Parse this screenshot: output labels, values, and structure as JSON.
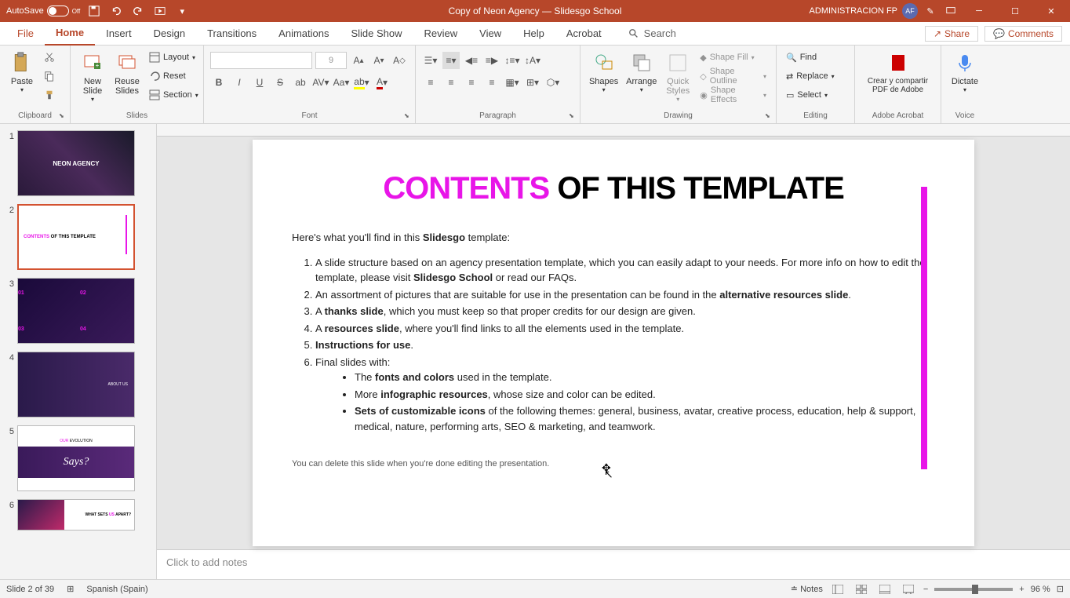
{
  "titlebar": {
    "autosave_label": "AutoSave",
    "autosave_state": "Off",
    "document_title": "Copy of Neon Agency — Slidesgo School",
    "user_name": "ADMINISTRACION FP",
    "user_initials": "AF"
  },
  "tabs": {
    "file": "File",
    "home": "Home",
    "insert": "Insert",
    "design": "Design",
    "transitions": "Transitions",
    "animations": "Animations",
    "slideshow": "Slide Show",
    "review": "Review",
    "view": "View",
    "help": "Help",
    "acrobat": "Acrobat",
    "search": "Search",
    "share": "Share",
    "comments": "Comments"
  },
  "ribbon": {
    "clipboard": {
      "label": "Clipboard",
      "paste": "Paste"
    },
    "slides": {
      "label": "Slides",
      "new_slide": "New\nSlide",
      "reuse_slides": "Reuse\nSlides",
      "layout": "Layout",
      "reset": "Reset",
      "section": "Section"
    },
    "font": {
      "label": "Font",
      "size": "9"
    },
    "paragraph": {
      "label": "Paragraph"
    },
    "drawing": {
      "label": "Drawing",
      "shapes": "Shapes",
      "arrange": "Arrange",
      "quick_styles": "Quick\nStyles",
      "shape_fill": "Shape Fill",
      "shape_outline": "Shape Outline",
      "shape_effects": "Shape Effects"
    },
    "editing": {
      "label": "Editing",
      "find": "Find",
      "replace": "Replace",
      "select": "Select"
    },
    "adobe": {
      "label": "Adobe Acrobat",
      "btn": "Crear y compartir\nPDF de Adobe"
    },
    "voice": {
      "label": "Voice",
      "dictate": "Dictate"
    }
  },
  "thumbnails": {
    "s1": {
      "num": "1",
      "title": "NEON AGENCY"
    },
    "s2": {
      "num": "2",
      "title": "CONTENTS OF THIS TEMPLATE"
    },
    "s3": {
      "num": "3",
      "labels": [
        "01",
        "02",
        "03",
        "04"
      ]
    },
    "s4": {
      "num": "4",
      "title": "ABOUT US"
    },
    "s5": {
      "num": "5",
      "title": "OUR EVOLUTION",
      "img_text": "Says?"
    },
    "s6": {
      "num": "6",
      "title": "WHAT SETS US APART?"
    }
  },
  "slide": {
    "title_accent": "CONTENTS",
    "title_rest": " OF THIS TEMPLATE",
    "intro_pre": "Here's what you'll find in this ",
    "intro_bold": "Slidesgo",
    "intro_post": " template:",
    "item1_a": "A slide structure based on an agency presentation template, which you can easily adapt to your needs. For more info on how to edit the template, please visit ",
    "item1_b": "Slidesgo School",
    "item1_c": " or read our FAQs.",
    "item2_a": "An assortment of pictures that are suitable for use in the presentation can be found in the ",
    "item2_b": "alternative resources slide",
    "item2_c": ".",
    "item3_a": "A ",
    "item3_b": "thanks slide",
    "item3_c": ", which you must keep so that proper credits for our design are given.",
    "item4_a": "A ",
    "item4_b": "resources slide",
    "item4_c": ", where you'll find links to all the elements used in the template.",
    "item5_a": "Instructions for use",
    "item5_b": ".",
    "item6": "Final slides with:",
    "sub1_a": "The ",
    "sub1_b": "fonts and colors",
    "sub1_c": " used in the template.",
    "sub2_a": "More ",
    "sub2_b": "infographic resources",
    "sub2_c": ", whose size and color can be edited.",
    "sub3_a": "Sets of customizable icons",
    "sub3_b": " of the following themes: general, business, avatar, creative process, education, help & support, medical, nature, performing arts, SEO & marketing, and teamwork.",
    "delete_note": "You can delete this slide when you're done editing the presentation."
  },
  "notes": {
    "placeholder": "Click to add notes"
  },
  "statusbar": {
    "slide_info": "Slide 2 of 39",
    "language": "Spanish (Spain)",
    "notes_btn": "Notes",
    "zoom": "96 %"
  }
}
